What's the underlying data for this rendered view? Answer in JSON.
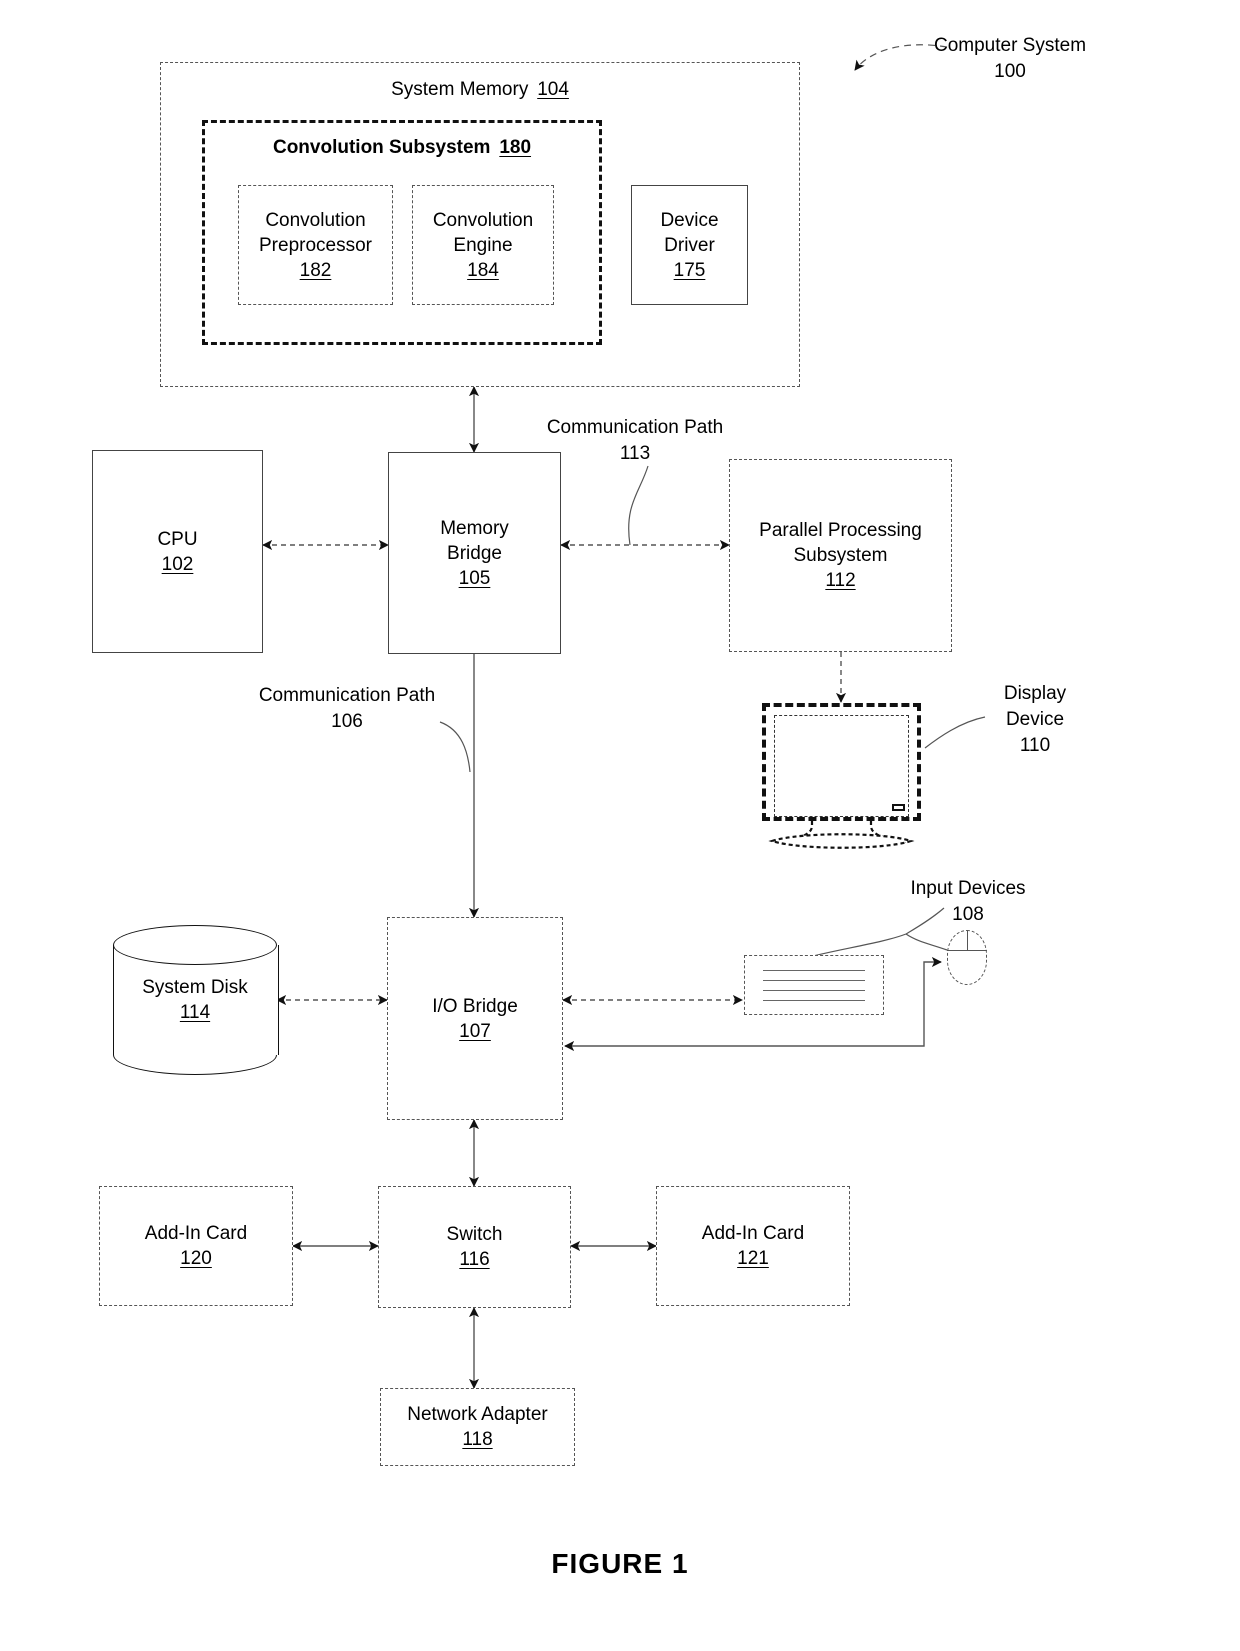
{
  "figure": {
    "caption": "FIGURE 1",
    "callout_computer_system": "Computer System\n100",
    "callout_display_device": "Display\nDevice\n110",
    "callout_input_devices": "Input Devices\n108",
    "callout_comm_path_113": "Communication Path\n113",
    "callout_comm_path_106": "Communication Path\n106"
  },
  "system_memory": {
    "title": "System Memory",
    "ref": "104"
  },
  "convolution_subsystem": {
    "title": "Convolution Subsystem",
    "ref": "180",
    "children": [
      {
        "label": "Convolution\nPreprocessor",
        "ref": "182"
      },
      {
        "label": "Convolution\nEngine",
        "ref": "184"
      }
    ]
  },
  "device_driver": {
    "label": "Device\nDriver",
    "ref": "175"
  },
  "blocks": {
    "cpu": {
      "label": "CPU",
      "ref": "102"
    },
    "memory_bridge": {
      "label": "Memory\nBridge",
      "ref": "105"
    },
    "parallel_processing": {
      "label": "Parallel Processing\nSubsystem",
      "ref": "112"
    },
    "io_bridge": {
      "label": "I/O Bridge",
      "ref": "107"
    },
    "system_disk": {
      "label": "System Disk",
      "ref": "114"
    },
    "switch": {
      "label": "Switch",
      "ref": "116"
    },
    "add_in_card_left": {
      "label": "Add-In Card",
      "ref": "120"
    },
    "add_in_card_right": {
      "label": "Add-In Card",
      "ref": "121"
    },
    "network_adapter": {
      "label": "Network Adapter",
      "ref": "118"
    }
  },
  "icons": {
    "display": "monitor-icon",
    "keyboard": "keyboard-icon",
    "mouse": "mouse-icon",
    "disk": "cylinder-disk-icon"
  },
  "colors": {
    "ink": "#000000",
    "line": "#555555",
    "background": "#ffffff"
  }
}
